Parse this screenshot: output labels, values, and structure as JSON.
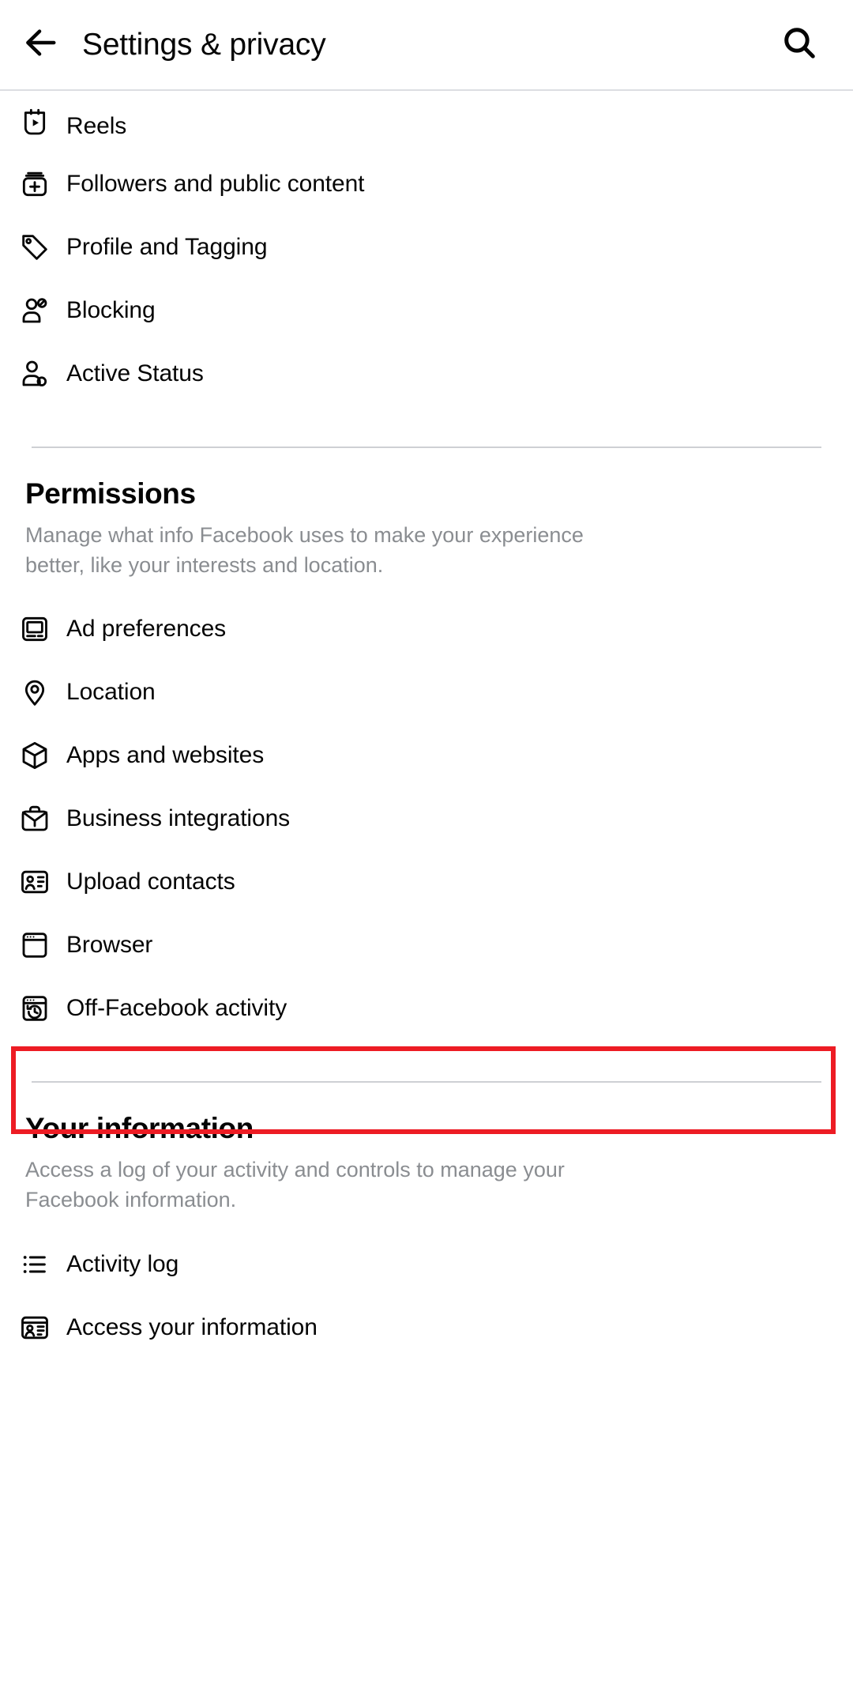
{
  "header": {
    "title": "Settings & privacy",
    "back_icon": "arrow-left-icon",
    "search_icon": "search-icon"
  },
  "top_list": [
    {
      "label": "Reels",
      "icon": "reels-icon"
    },
    {
      "label": "Followers and public content",
      "icon": "followers-icon"
    },
    {
      "label": "Profile and Tagging",
      "icon": "tag-icon"
    },
    {
      "label": "Blocking",
      "icon": "person-block-icon"
    },
    {
      "label": "Active Status",
      "icon": "person-active-icon"
    }
  ],
  "permissions": {
    "title": "Permissions",
    "description": "Manage what info Facebook uses to make your experience better, like your interests and location.",
    "items": [
      {
        "label": "Ad preferences",
        "icon": "monitor-icon"
      },
      {
        "label": "Location",
        "icon": "location-pin-icon"
      },
      {
        "label": "Apps and websites",
        "icon": "cube-icon"
      },
      {
        "label": "Business integrations",
        "icon": "briefcase-icon"
      },
      {
        "label": "Upload contacts",
        "icon": "contact-card-icon"
      },
      {
        "label": "Browser",
        "icon": "browser-window-icon"
      },
      {
        "label": "Off-Facebook activity",
        "icon": "browser-history-icon"
      }
    ]
  },
  "your_information": {
    "title": "Your information",
    "description": "Access a log of your activity and controls to manage your Facebook information.",
    "items": [
      {
        "label": "Activity log",
        "icon": "list-icon"
      },
      {
        "label": "Access your information",
        "icon": "id-card-icon"
      }
    ]
  },
  "highlight": {
    "target_label": "Upload contacts",
    "color": "#ed1c24"
  },
  "colors": {
    "text_primary": "#050505",
    "text_secondary": "#8a8d91",
    "divider": "#ced0d4",
    "background": "#ffffff",
    "highlight": "#ed1c24"
  }
}
